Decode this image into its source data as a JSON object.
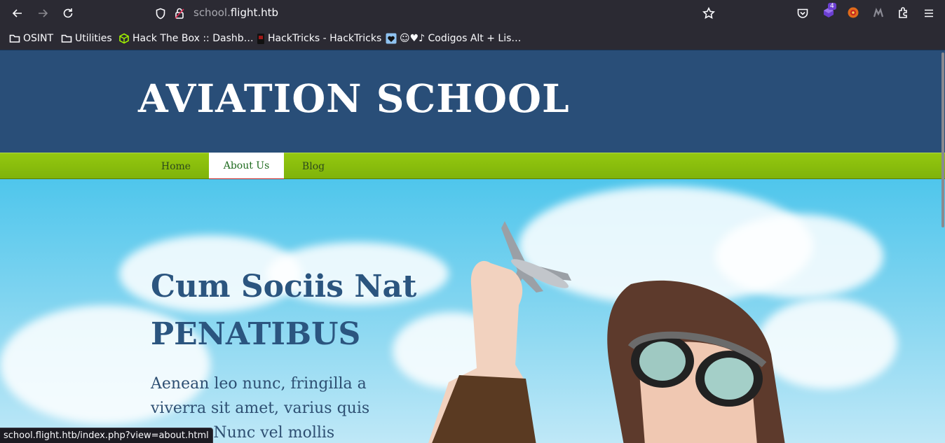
{
  "browser": {
    "url_host_dim": "school.",
    "url_host": "flight.htb",
    "extension_badge": "4",
    "status_url": "school.flight.htb/index.php?view=about.html"
  },
  "bookmarks": [
    {
      "label": "OSINT",
      "icon": "folder-icon"
    },
    {
      "label": "Utilities",
      "icon": "folder-icon"
    },
    {
      "label": "Hack The Box :: Dashb…",
      "icon": "htb-cube-icon"
    },
    {
      "label": "HackTricks - HackTricks",
      "icon": "hacktricks-icon"
    },
    {
      "label": "☺♥♪ Codigos Alt + Lis…",
      "icon": "heart-card-icon"
    }
  ],
  "site": {
    "title": "AVIATION SCHOOL",
    "nav": [
      "Home",
      "About Us",
      "Blog"
    ],
    "active_nav": "About Us",
    "hero_heading_line1": "Cum Sociis Nat",
    "hero_heading_line2": "PENATIBUS",
    "hero_text": "Aenean leo nunc, fringilla a viverra sit amet, varius quis magna. Nunc vel mollis"
  },
  "colors": {
    "header_bg": "#294e78",
    "nav_bg": "#86bd0c",
    "active_underline": "#c41818",
    "heading": "#2b557f"
  }
}
